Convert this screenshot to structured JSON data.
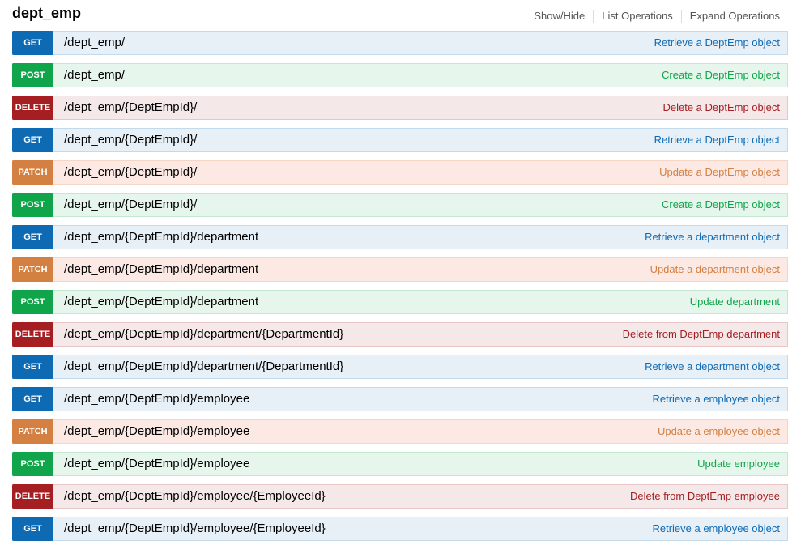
{
  "resource": {
    "title": "dept_emp",
    "links": [
      "Show/Hide",
      "List Operations",
      "Expand Operations"
    ]
  },
  "operations": [
    {
      "method": "GET",
      "kind": "get",
      "path": "/dept_emp/",
      "summary": "Retrieve a DeptEmp object"
    },
    {
      "method": "POST",
      "kind": "post",
      "path": "/dept_emp/",
      "summary": "Create a DeptEmp object"
    },
    {
      "method": "DELETE",
      "kind": "delete",
      "path": "/dept_emp/{DeptEmpId}/",
      "summary": "Delete a DeptEmp object"
    },
    {
      "method": "GET",
      "kind": "get",
      "path": "/dept_emp/{DeptEmpId}/",
      "summary": "Retrieve a DeptEmp object"
    },
    {
      "method": "PATCH",
      "kind": "patch",
      "path": "/dept_emp/{DeptEmpId}/",
      "summary": "Update a DeptEmp object"
    },
    {
      "method": "POST",
      "kind": "post",
      "path": "/dept_emp/{DeptEmpId}/",
      "summary": "Create a DeptEmp object"
    },
    {
      "method": "GET",
      "kind": "get",
      "path": "/dept_emp/{DeptEmpId}/department",
      "summary": "Retrieve a department object"
    },
    {
      "method": "PATCH",
      "kind": "patch",
      "path": "/dept_emp/{DeptEmpId}/department",
      "summary": "Update a department object"
    },
    {
      "method": "POST",
      "kind": "post",
      "path": "/dept_emp/{DeptEmpId}/department",
      "summary": "Update department"
    },
    {
      "method": "DELETE",
      "kind": "delete",
      "path": "/dept_emp/{DeptEmpId}/department/{DepartmentId}",
      "summary": "Delete from DeptEmp department"
    },
    {
      "method": "GET",
      "kind": "get",
      "path": "/dept_emp/{DeptEmpId}/department/{DepartmentId}",
      "summary": "Retrieve a department object"
    },
    {
      "method": "GET",
      "kind": "get",
      "path": "/dept_emp/{DeptEmpId}/employee",
      "summary": "Retrieve a employee object"
    },
    {
      "method": "PATCH",
      "kind": "patch",
      "path": "/dept_emp/{DeptEmpId}/employee",
      "summary": "Update a employee object"
    },
    {
      "method": "POST",
      "kind": "post",
      "path": "/dept_emp/{DeptEmpId}/employee",
      "summary": "Update employee"
    },
    {
      "method": "DELETE",
      "kind": "delete",
      "path": "/dept_emp/{DeptEmpId}/employee/{EmployeeId}",
      "summary": "Delete from DeptEmp employee"
    },
    {
      "method": "GET",
      "kind": "get",
      "path": "/dept_emp/{DeptEmpId}/employee/{EmployeeId}",
      "summary": "Retrieve a employee object"
    }
  ]
}
